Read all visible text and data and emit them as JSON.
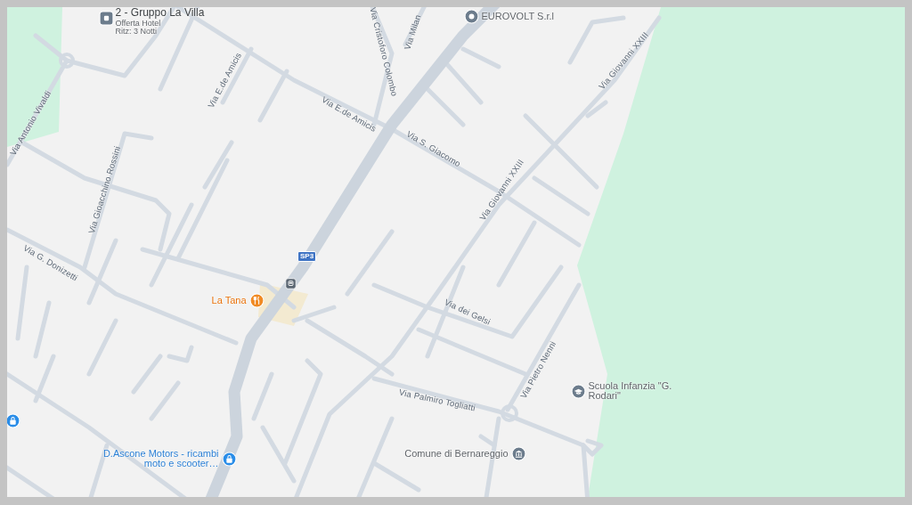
{
  "map": {
    "pois": [
      {
        "kind": "hotel",
        "label": "2 - Gruppo La Villa",
        "sublabel": "Offerta Hotel Ritz: 3 Notti"
      },
      {
        "kind": "place",
        "label": "EUROVOLT S.r.l"
      },
      {
        "kind": "restaurant",
        "label": "La Tana"
      },
      {
        "kind": "transit"
      },
      {
        "kind": "shop",
        "label": "D.Ascone Motors - ricambi moto e scooter…"
      },
      {
        "kind": "shop"
      },
      {
        "kind": "school",
        "label": "Scuola Infanzia \"G. Rodari\""
      },
      {
        "kind": "townhall",
        "label": "Comune di Bernareggio"
      }
    ],
    "street_labels": [
      "Via Milan",
      "Via Cristoforo Colombo",
      "Via E.de Amicis",
      "Via E.de Amicis",
      "Via S. Giacomo",
      "Via Giovanni XXIII",
      "Via Giovanni XXIII",
      "Via Antonio Vivaldi",
      "Via Gioacchino Rossini",
      "Via G. Donizetti",
      "Via dei Gelsi",
      "Via Pietro Nenni",
      "Via Palmiro Togliatti"
    ],
    "route_shields": [
      "SP3"
    ]
  }
}
